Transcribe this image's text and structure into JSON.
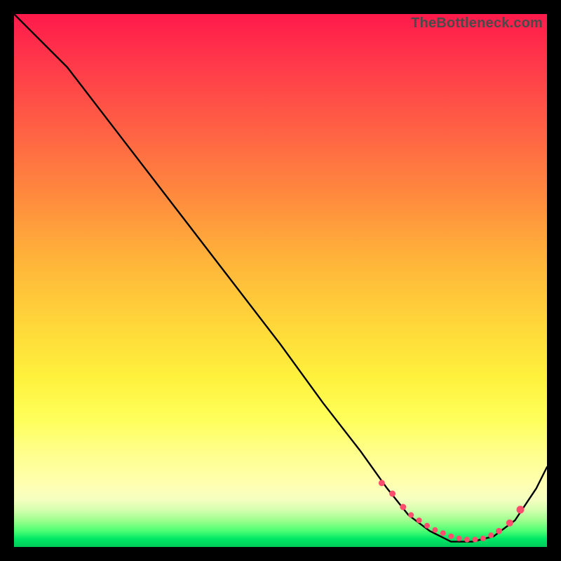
{
  "watermark": "TheBottleneck.com",
  "chart_data": {
    "type": "line",
    "title": "",
    "xlabel": "",
    "ylabel": "",
    "xlim": [
      0,
      100
    ],
    "ylim": [
      0,
      100
    ],
    "grid": false,
    "series": [
      {
        "name": "bottleneck-curve",
        "x": [
          0,
          3,
          6,
          10,
          20,
          30,
          40,
          50,
          58,
          65,
          70,
          74,
          78,
          82,
          86,
          90,
          94,
          98,
          100
        ],
        "values": [
          100,
          97,
          94,
          90,
          77,
          64,
          51,
          38,
          27,
          18,
          11,
          6,
          3,
          1,
          1,
          2,
          5,
          11,
          15
        ]
      }
    ],
    "markers": {
      "name": "optimal-range-dots",
      "x": [
        69,
        71,
        73,
        74.5,
        76,
        77.5,
        79,
        80.5,
        82,
        83.5,
        85,
        86.5,
        88,
        89.5,
        91,
        93,
        95
      ],
      "values": [
        12,
        10,
        7.5,
        6,
        5,
        4,
        3.2,
        2.6,
        2,
        1.6,
        1.4,
        1.4,
        1.6,
        2.2,
        3,
        4.5,
        7
      ],
      "color": "#ff4d6d",
      "size": [
        4.5,
        4.5,
        4.5,
        4,
        4,
        4,
        4,
        4,
        4,
        4,
        4,
        4,
        4,
        4,
        4.5,
        5,
        5.5
      ]
    }
  }
}
